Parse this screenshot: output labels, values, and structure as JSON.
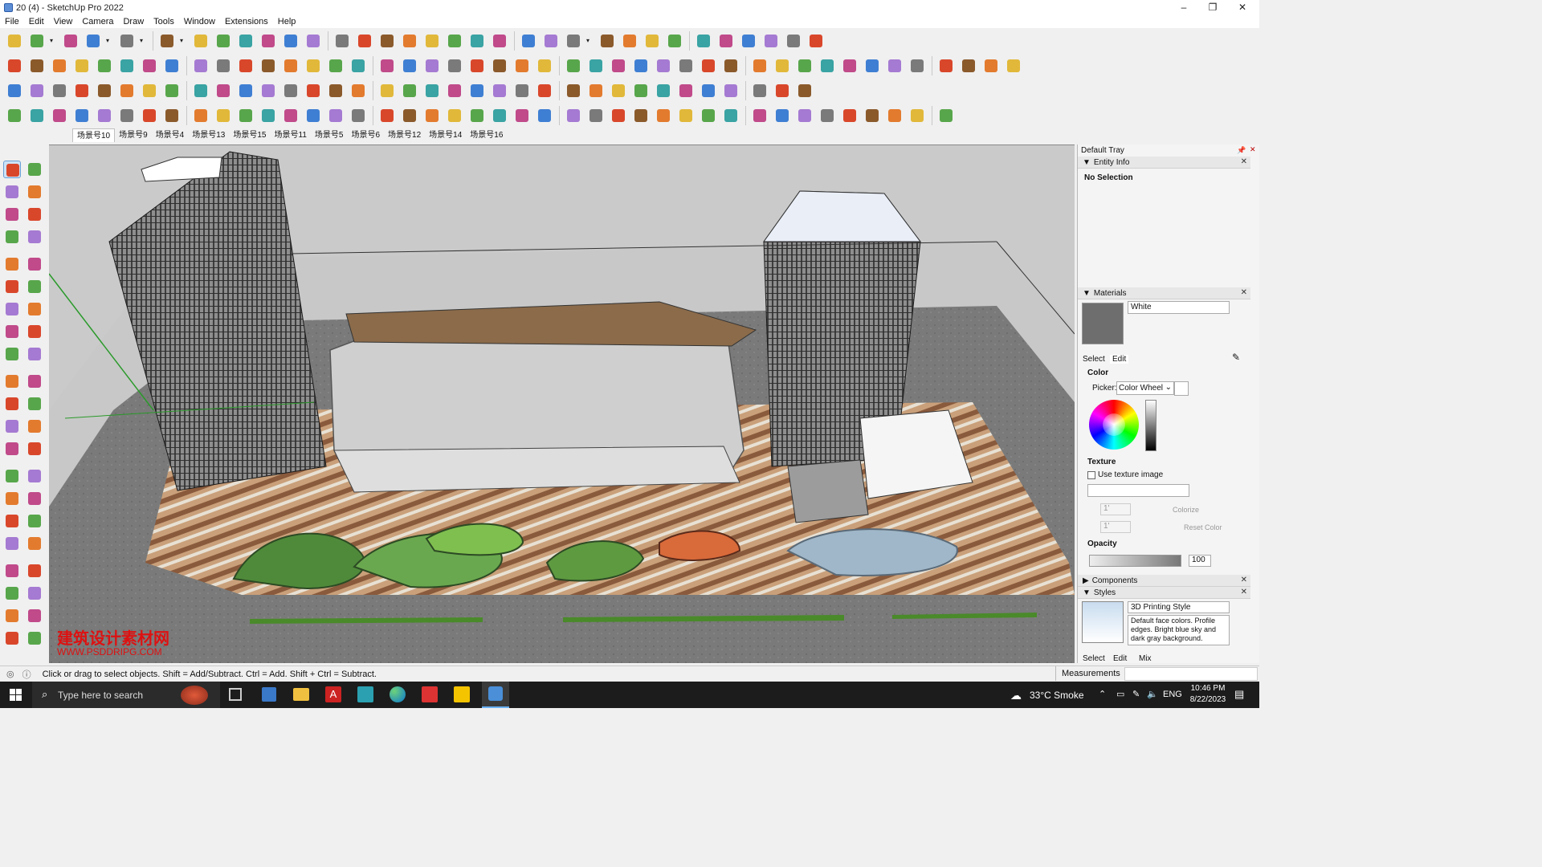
{
  "window": {
    "title": "20 (4) - SketchUp Pro 2022",
    "minimize": "–",
    "maximize": "❐",
    "close": "✕"
  },
  "menu": [
    "File",
    "Edit",
    "View",
    "Camera",
    "Draw",
    "Tools",
    "Window",
    "Extensions",
    "Help"
  ],
  "toolbar_icons": {
    "row1": [
      "search-icon",
      "select-icon",
      "dropdown-icon",
      "eraser-icon",
      "pencil-icon",
      "dropdown-icon",
      "lasso-icon",
      "dropdown-icon",
      "rectangle-icon",
      "dropdown-icon",
      "pushpull-icon",
      "followme-icon",
      "move-icon",
      "rotate-icon",
      "scale-icon",
      "tape-icon",
      "text-icon",
      "paint-icon",
      "orbit-icon",
      "pan-icon",
      "zoom-icon",
      "zoom-extents-icon",
      "warehouse-icon",
      "extension-icon",
      "layers-icon",
      "gear-icon",
      "user-icon",
      "dropdown-icon",
      "section-icon",
      "section-fill-icon",
      "axes-icon",
      "arrows-icon",
      "arrows2-icon",
      "dims-icon",
      "box-icon",
      "undo-icon",
      "redo-icon",
      "scene-icon"
    ],
    "row2": [
      "cube-yellow-icon",
      "cube-white-icon",
      "cube-green-icon",
      "fire-icon",
      "stamp-icon",
      "stamp2-icon",
      "stamp3-icon",
      "stamp4-icon",
      "stamp5-icon",
      "stamp6-icon",
      "stamp7-icon",
      "curve-icon",
      "face-icon",
      "face2-icon",
      "face3-icon",
      "surface-icon",
      "surface2-icon",
      "house-icon",
      "house2-icon",
      "house3-icon",
      "house4-icon",
      "house5-icon",
      "fx-icon",
      "leaf-icon",
      "knife-icon",
      "shape1-icon",
      "circle-icon",
      "hexagon-icon",
      "ellipse-icon",
      "parallelogram-icon",
      "arc-icon",
      "blob-icon",
      "lasso2-icon",
      "diamond-icon",
      "spiral-icon",
      "ruler-icon",
      "eraser2-icon",
      "brick-icon",
      "grid-icon",
      "cut-icon",
      "cut2-icon",
      "cube2-icon",
      "plane-icon",
      "plane2-icon"
    ],
    "row3": [
      "layer-blue-icon",
      "layer-blue2-icon",
      "layer-yellow-icon",
      "tag-icon",
      "ring-icon",
      "stack-icon",
      "box3-icon",
      "frame-icon",
      "beam-icon",
      "wrench-icon",
      "join-icon",
      "chain-icon",
      "plus-red-icon",
      "plus-green-icon",
      "cross-icon",
      "cone-icon",
      "triangle-icon",
      "ring2-icon",
      "ring3-icon",
      "ring4-icon",
      "move2-icon",
      "bucket-icon",
      "magnet-icon",
      "tree-icon",
      "paint2-icon",
      "paint3-icon",
      "paint4-icon",
      "gear2-icon",
      "wall-icon",
      "grid2-icon",
      "grid3-icon",
      "grid4-icon",
      "dots-icon",
      "bezier-icon",
      "qr-icon"
    ],
    "row4": [
      "curve2-icon",
      "curve3-icon",
      "car-icon",
      "sphere-icon",
      "rings-icon",
      "fan-icon",
      "hook-icon",
      "pipe-icon",
      "bend-icon",
      "path-icon",
      "path2-icon",
      "line-icon",
      "spring-icon",
      "spring2-icon",
      "lathe-icon",
      "bars-icon",
      "bars2-icon",
      "fish-icon",
      "dome-icon",
      "stack2-icon",
      "plank-icon",
      "plank3-icon",
      "plank4-icon",
      "tower-icon",
      "plank5-icon",
      "comb-icon",
      "comb2-icon",
      "fan2-icon",
      "fan3-icon",
      "stair-icon",
      "stair2-icon",
      "fence-icon",
      "fence2-icon",
      "grid5-icon",
      "grid6-icon",
      "fence3-icon",
      "net-icon",
      "net2-icon",
      "wave-icon",
      "wave2-icon",
      "shell-icon"
    ]
  },
  "scenes": [
    "场景号10",
    "场景号9",
    "场景号4",
    "场景号13",
    "场景号15",
    "场景号11",
    "场景号5",
    "场景号6",
    "场景号12",
    "场景号14",
    "场景号16"
  ],
  "tray": {
    "title": "Default Tray",
    "entity_info": {
      "header": "Entity Info",
      "selection": "No Selection"
    },
    "materials": {
      "header": "Materials",
      "name": "White",
      "tab_select": "Select",
      "tab_edit": "Edit",
      "color_label": "Color",
      "picker_label": "Picker:",
      "picker_value": "Color Wheel",
      "texture_label": "Texture",
      "use_texture": "Use texture image",
      "dim1": "1'",
      "dim2": "1'",
      "colorize": "Colorize",
      "reset_color": "Reset Color",
      "opacity_label": "Opacity",
      "opacity_value": "100"
    },
    "components": {
      "header": "Components"
    },
    "styles": {
      "header": "Styles",
      "name": "3D Printing Style",
      "description": "Default face colors. Profile edges. Bright blue sky and dark gray background.",
      "tab_select": "Select",
      "tab_edit": "Edit",
      "tab_mix": "Mix"
    }
  },
  "viewport": {
    "watermark_cn": "建筑设计素材网",
    "watermark_url": "WWW.PSDDRIPG.COM"
  },
  "status": {
    "hint": "Click or drag to select objects. Shift = Add/Subtract. Ctrl = Add. Shift + Ctrl = Subtract.",
    "measurements_label": "Measurements",
    "measurements_value": ""
  },
  "taskbar": {
    "search_placeholder": "Type here to search",
    "weather": "33°C  Smoke",
    "lang": "ENG",
    "time": "10:46 PM",
    "date": "8/22/2023"
  },
  "colors": {
    "accent": "#0078d7",
    "ground": "#767676",
    "grass": "#7ca04a"
  }
}
